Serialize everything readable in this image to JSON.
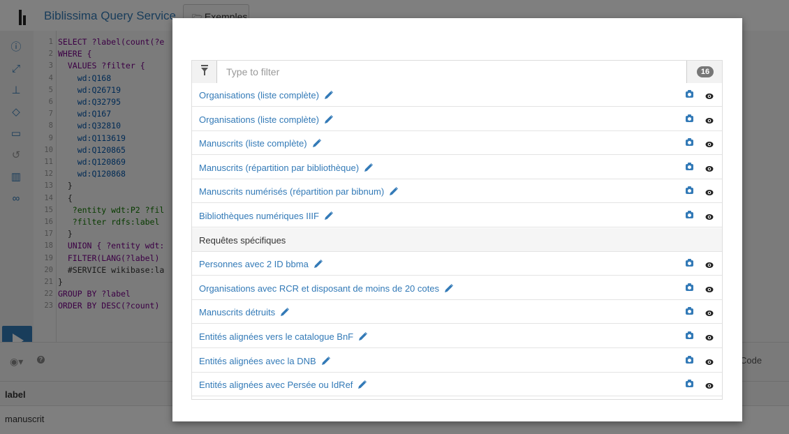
{
  "app": {
    "title": "Biblissima Query Service",
    "examples_label": "Exemples",
    "code_lines": [
      {
        "num": "1",
        "text": "SELECT ?label(count(?e",
        "cls": ""
      },
      {
        "num": "2",
        "text": "WHERE {",
        "cls": ""
      },
      {
        "num": "3",
        "text": "  VALUES ?filter {",
        "cls": ""
      },
      {
        "num": "4",
        "text": "    wd:Q168",
        "cls": "v"
      },
      {
        "num": "5",
        "text": "    wd:Q26719",
        "cls": "v"
      },
      {
        "num": "6",
        "text": "    wd:Q32795",
        "cls": "v"
      },
      {
        "num": "7",
        "text": "    wd:Q167",
        "cls": "v"
      },
      {
        "num": "8",
        "text": "    wd:Q32810",
        "cls": "v"
      },
      {
        "num": "9",
        "text": "    wd:Q113619",
        "cls": "v"
      },
      {
        "num": "10",
        "text": "    wd:Q120865",
        "cls": "v"
      },
      {
        "num": "11",
        "text": "    wd:Q120869",
        "cls": "v"
      },
      {
        "num": "12",
        "text": "    wd:Q120868",
        "cls": "v"
      },
      {
        "num": "13",
        "text": "  }",
        "cls": "d"
      },
      {
        "num": "14",
        "text": "  {",
        "cls": "d"
      },
      {
        "num": "15",
        "text": "   ?entity wdt:P2 ?fil",
        "cls": "t"
      },
      {
        "num": "16",
        "text": "   ?filter rdfs:label",
        "cls": "t"
      },
      {
        "num": "17",
        "text": "  }",
        "cls": "d"
      },
      {
        "num": "18",
        "text": "  UNION { ?entity wdt:",
        "cls": ""
      },
      {
        "num": "19",
        "text": "  FILTER(LANG(?label)",
        "cls": ""
      },
      {
        "num": "20",
        "text": "  #SERVICE wikibase:la",
        "cls": "d"
      },
      {
        "num": "21",
        "text": "}",
        "cls": "d"
      },
      {
        "num": "22",
        "text": "GROUP BY ?label",
        "cls": ""
      },
      {
        "num": "23",
        "text": "ORDER BY DESC(?count)",
        "cls": ""
      }
    ],
    "results_code_label": "Code",
    "table_header": "label",
    "table_row_1": "manuscrit"
  },
  "modal": {
    "filter_placeholder": "Type to filter",
    "count": "16",
    "rows": [
      {
        "label": "Organisations (liste complète)",
        "section": false
      },
      {
        "label": "Organisations (liste complète)",
        "section": false
      },
      {
        "label": "Manuscrits (liste complète)",
        "section": false
      },
      {
        "label": "Manuscrits (répartition par bibliothèque)",
        "section": false
      },
      {
        "label": "Manuscrits numérisés (répartition par bibnum)",
        "section": false
      },
      {
        "label": "Bibliothèques numériques IIIF",
        "section": false
      },
      {
        "label": "Requêtes spécifiques",
        "section": true
      },
      {
        "label": "Personnes avec 2 ID bbma",
        "section": false
      },
      {
        "label": "Organisations avec RCR et disposant de moins de 20 cotes",
        "section": false
      },
      {
        "label": "Manuscrits détruits",
        "section": false
      },
      {
        "label": "Entités alignées vers le catalogue BnF",
        "section": false
      },
      {
        "label": "Entités alignées avec la DNB",
        "section": false
      },
      {
        "label": "Entités alignées avec Persée ou IdRef",
        "section": false
      }
    ]
  },
  "colors": {
    "link": "#337ab7",
    "run_button": "#337ab7",
    "badge": "#777777"
  },
  "icons": {
    "row_edit": "pencil-icon",
    "row_preview": "camera-icon",
    "row_view": "eye-icon",
    "filter": "filter-icon"
  }
}
